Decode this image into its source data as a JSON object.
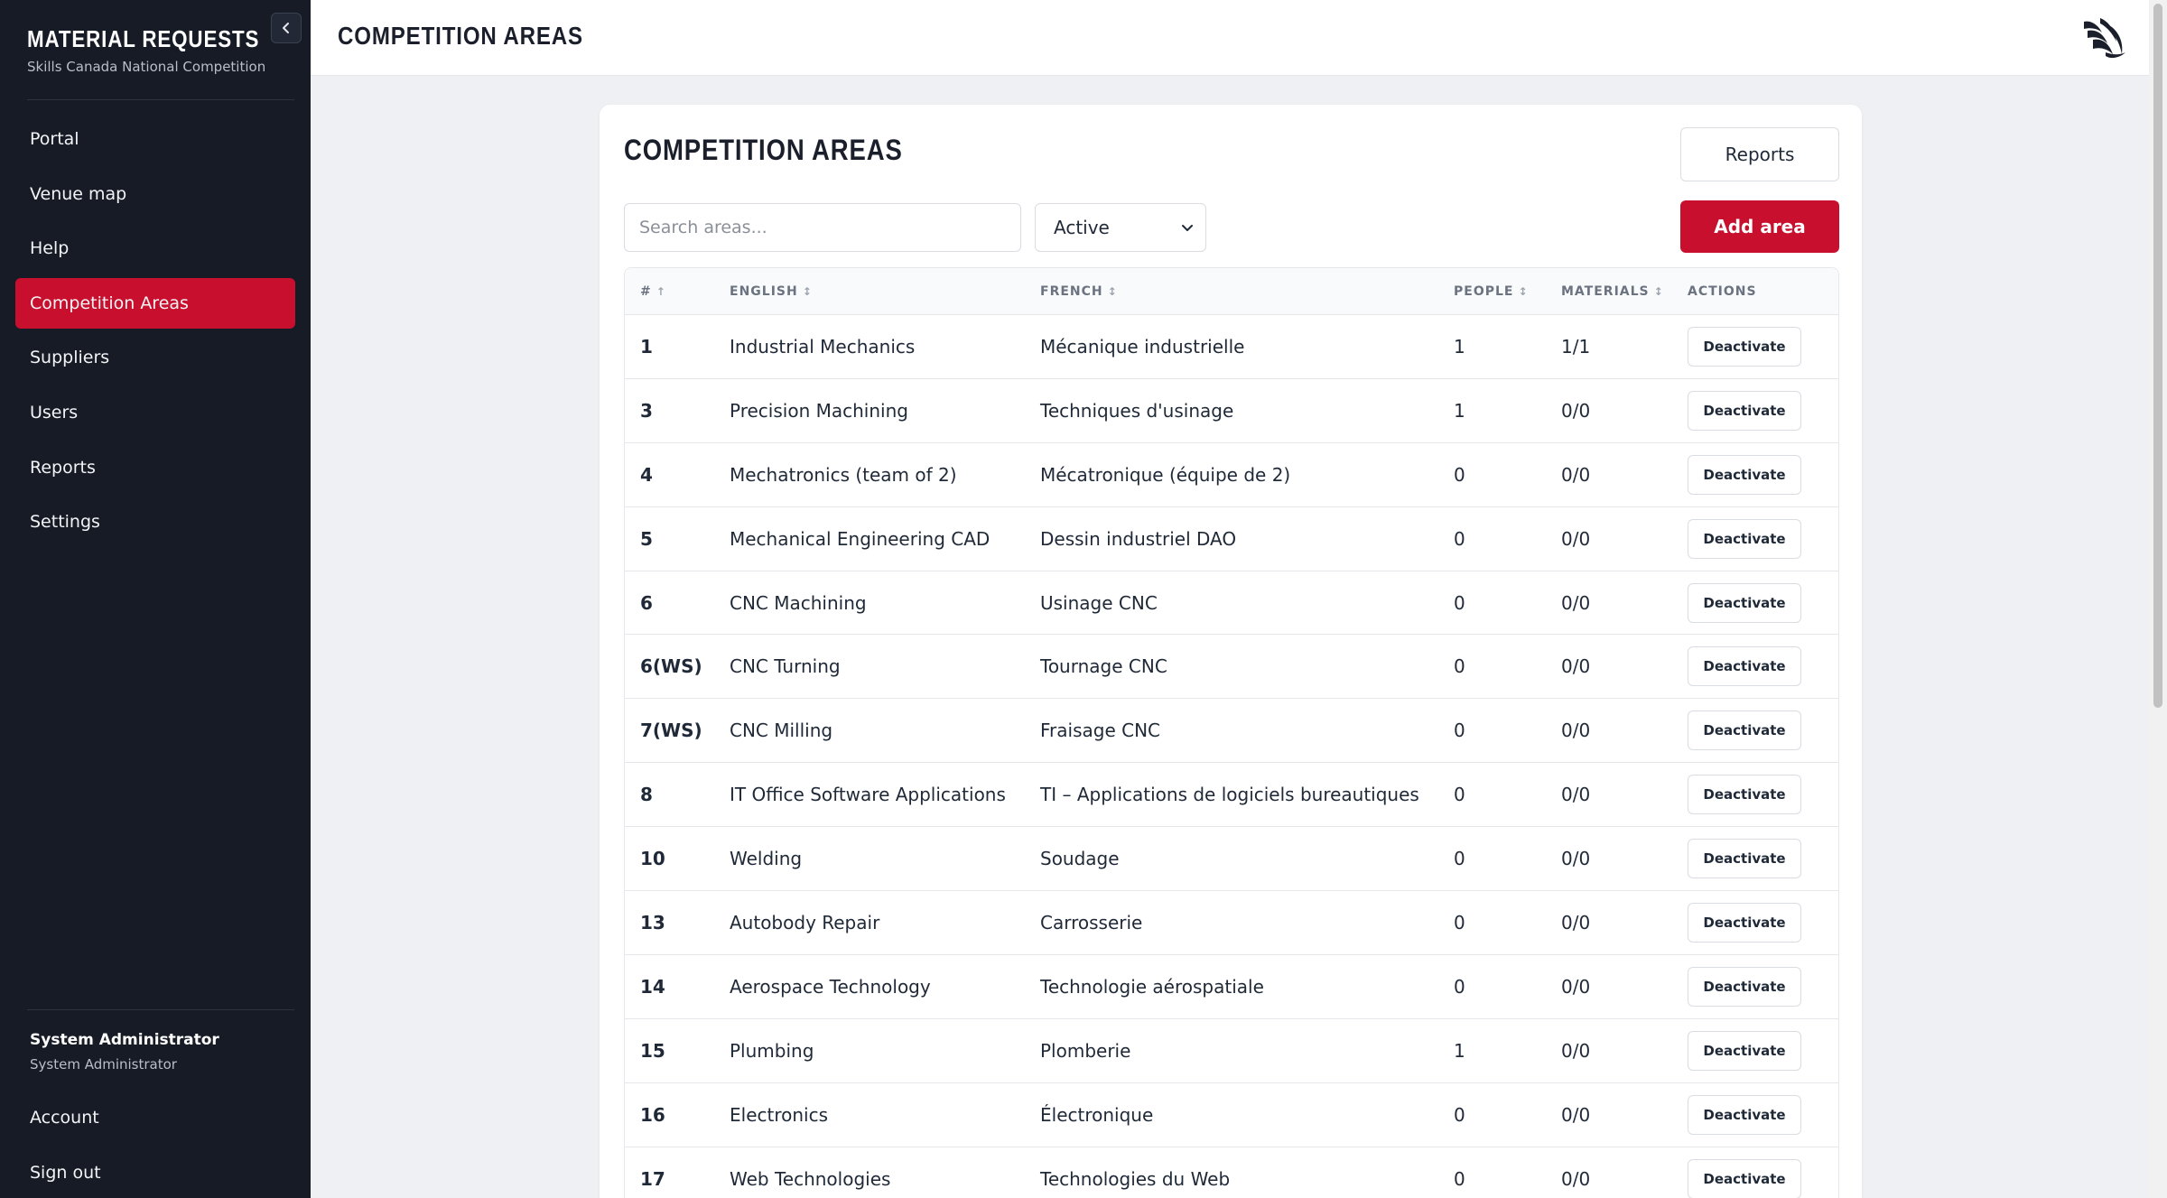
{
  "sidebar": {
    "brand_title": "MATERIAL REQUESTS",
    "brand_subtitle": "Skills Canada National Competition",
    "nav_items": [
      {
        "label": "Portal"
      },
      {
        "label": "Venue map"
      },
      {
        "label": "Help"
      },
      {
        "label": "Competition Areas",
        "active": true
      },
      {
        "label": "Suppliers"
      },
      {
        "label": "Users"
      },
      {
        "label": "Reports"
      },
      {
        "label": "Settings"
      }
    ],
    "user_name": "System Administrator",
    "user_role": "System Administrator",
    "account_label": "Account",
    "signout_label": "Sign out"
  },
  "topbar": {
    "title": "COMPETITION AREAS",
    "logo_icon": "skills-logo-icon"
  },
  "card": {
    "title": "COMPETITION AREAS",
    "reports_label": "Reports",
    "search_placeholder": "Search areas...",
    "status_selected": "Active",
    "add_label": "Add area"
  },
  "table": {
    "headers": {
      "num": "#",
      "english": "ENGLISH",
      "french": "FRENCH",
      "people": "PEOPLE",
      "materials": "MATERIALS",
      "actions": "ACTIONS"
    },
    "rows": [
      {
        "num": "1",
        "english": "Industrial Mechanics",
        "french": "Mécanique industrielle",
        "people": "1",
        "materials": "1/1",
        "action": "Deactivate"
      },
      {
        "num": "3",
        "english": "Precision Machining",
        "french": "Techniques d'usinage",
        "people": "1",
        "materials": "0/0",
        "action": "Deactivate"
      },
      {
        "num": "4",
        "english": "Mechatronics (team of 2)",
        "french": "Mécatronique (équipe de 2)",
        "people": "0",
        "materials": "0/0",
        "action": "Deactivate"
      },
      {
        "num": "5",
        "english": "Mechanical Engineering CAD",
        "french": "Dessin industriel DAO",
        "people": "0",
        "materials": "0/0",
        "action": "Deactivate"
      },
      {
        "num": "6",
        "english": "CNC Machining",
        "french": "Usinage CNC",
        "people": "0",
        "materials": "0/0",
        "action": "Deactivate"
      },
      {
        "num": "6(WS)",
        "english": "CNC Turning",
        "french": "Tournage CNC",
        "people": "0",
        "materials": "0/0",
        "action": "Deactivate"
      },
      {
        "num": "7(WS)",
        "english": "CNC Milling",
        "french": "Fraisage CNC",
        "people": "0",
        "materials": "0/0",
        "action": "Deactivate"
      },
      {
        "num": "8",
        "english": "IT Office Software Applications",
        "french": "TI – Applications de logiciels bureautiques",
        "people": "0",
        "materials": "0/0",
        "action": "Deactivate"
      },
      {
        "num": "10",
        "english": "Welding",
        "french": "Soudage",
        "people": "0",
        "materials": "0/0",
        "action": "Deactivate"
      },
      {
        "num": "13",
        "english": "Autobody Repair",
        "french": "Carrosserie",
        "people": "0",
        "materials": "0/0",
        "action": "Deactivate"
      },
      {
        "num": "14",
        "english": "Aerospace Technology",
        "french": "Technologie aérospatiale",
        "people": "0",
        "materials": "0/0",
        "action": "Deactivate"
      },
      {
        "num": "15",
        "english": "Plumbing",
        "french": "Plomberie",
        "people": "1",
        "materials": "0/0",
        "action": "Deactivate"
      },
      {
        "num": "16",
        "english": "Electronics",
        "french": "Électronique",
        "people": "0",
        "materials": "0/0",
        "action": "Deactivate"
      },
      {
        "num": "17",
        "english": "Web Technologies",
        "french": "Technologies du Web",
        "people": "0",
        "materials": "0/0",
        "action": "Deactivate"
      }
    ]
  },
  "colors": {
    "accent": "#c8102e",
    "sidebar_bg": "#161b26"
  }
}
